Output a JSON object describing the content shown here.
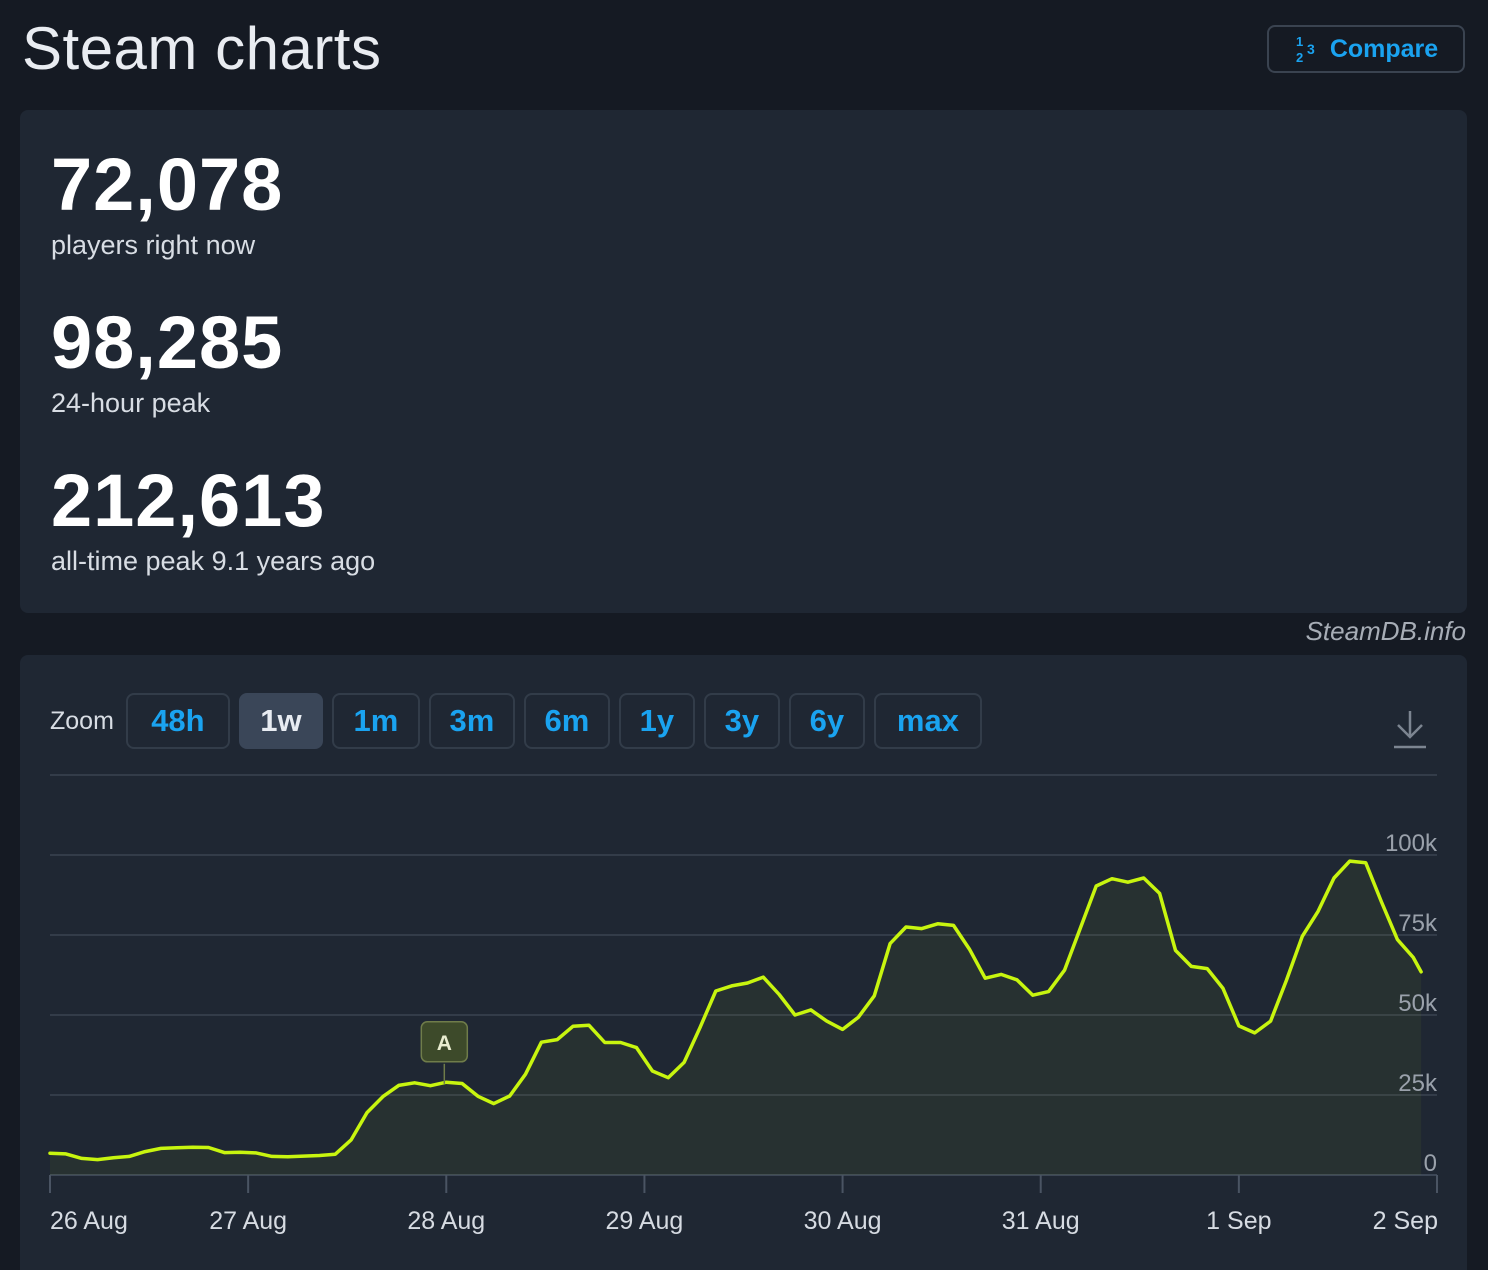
{
  "header": {
    "title": "Steam charts",
    "compare_label": "Compare",
    "compare_icon": "numbers-icon"
  },
  "stats": [
    {
      "value": "72,078",
      "label": "players right now"
    },
    {
      "value": "98,285",
      "label": "24-hour peak"
    },
    {
      "value": "212,613",
      "label": "all-time peak 9.1 years ago"
    }
  ],
  "watermark": "SteamDB.info",
  "zoom": {
    "label": "Zoom",
    "options": [
      "48h",
      "1w",
      "1m",
      "3m",
      "6m",
      "1y",
      "3y",
      "6y",
      "max"
    ],
    "active": "1w"
  },
  "download_icon": "download-icon",
  "chart_data": {
    "type": "area",
    "x_unit": "days",
    "x_ticks": [
      "26 Aug",
      "27 Aug",
      "28 Aug",
      "29 Aug",
      "30 Aug",
      "31 Aug",
      "1 Sep",
      "2 Sep"
    ],
    "y_ticks": [
      "0",
      "25k",
      "50k",
      "75k",
      "100k"
    ],
    "ylim": [
      0,
      125000
    ],
    "grid": true,
    "line_color": "#c8f50f",
    "annotation": {
      "label": "A",
      "x": 1.99,
      "y": 28500
    },
    "series": [
      {
        "values": [
          [
            0.0,
            6800
          ],
          [
            0.08,
            6600
          ],
          [
            0.16,
            5200
          ],
          [
            0.24,
            4800
          ],
          [
            0.32,
            5400
          ],
          [
            0.4,
            5800
          ],
          [
            0.48,
            7300
          ],
          [
            0.56,
            8300
          ],
          [
            0.64,
            8500
          ],
          [
            0.72,
            8700
          ],
          [
            0.8,
            8600
          ],
          [
            0.88,
            7000
          ],
          [
            0.96,
            7100
          ],
          [
            1.04,
            6900
          ],
          [
            1.12,
            5800
          ],
          [
            1.2,
            5700
          ],
          [
            1.28,
            5900
          ],
          [
            1.36,
            6100
          ],
          [
            1.44,
            6500
          ],
          [
            1.52,
            11000
          ],
          [
            1.6,
            19500
          ],
          [
            1.68,
            24500
          ],
          [
            1.76,
            28000
          ],
          [
            1.84,
            28800
          ],
          [
            1.92,
            27900
          ],
          [
            2.0,
            29000
          ],
          [
            2.08,
            28600
          ],
          [
            2.16,
            24600
          ],
          [
            2.24,
            22300
          ],
          [
            2.32,
            24700
          ],
          [
            2.4,
            31500
          ],
          [
            2.48,
            41500
          ],
          [
            2.56,
            42300
          ],
          [
            2.64,
            46500
          ],
          [
            2.72,
            46800
          ],
          [
            2.8,
            41400
          ],
          [
            2.88,
            41400
          ],
          [
            2.96,
            39800
          ],
          [
            3.04,
            32500
          ],
          [
            3.12,
            30400
          ],
          [
            3.2,
            35200
          ],
          [
            3.28,
            46000
          ],
          [
            3.36,
            57500
          ],
          [
            3.44,
            59100
          ],
          [
            3.52,
            60000
          ],
          [
            3.6,
            61800
          ],
          [
            3.68,
            56400
          ],
          [
            3.76,
            50000
          ],
          [
            3.84,
            51600
          ],
          [
            3.92,
            48100
          ],
          [
            4.0,
            45500
          ],
          [
            4.08,
            49300
          ],
          [
            4.16,
            56000
          ],
          [
            4.24,
            72300
          ],
          [
            4.32,
            77500
          ],
          [
            4.4,
            77000
          ],
          [
            4.48,
            78500
          ],
          [
            4.56,
            78000
          ],
          [
            4.64,
            70600
          ],
          [
            4.72,
            61500
          ],
          [
            4.8,
            62700
          ],
          [
            4.88,
            61000
          ],
          [
            4.96,
            56200
          ],
          [
            5.04,
            57300
          ],
          [
            5.12,
            64000
          ],
          [
            5.2,
            77100
          ],
          [
            5.28,
            90300
          ],
          [
            5.36,
            92600
          ],
          [
            5.44,
            91500
          ],
          [
            5.52,
            92800
          ],
          [
            5.6,
            88000
          ],
          [
            5.68,
            70200
          ],
          [
            5.76,
            65200
          ],
          [
            5.84,
            64500
          ],
          [
            5.92,
            58300
          ],
          [
            6.0,
            46600
          ],
          [
            6.08,
            44400
          ],
          [
            6.16,
            48100
          ],
          [
            6.24,
            60800
          ],
          [
            6.32,
            74600
          ],
          [
            6.4,
            82400
          ],
          [
            6.48,
            92800
          ],
          [
            6.56,
            98100
          ],
          [
            6.64,
            97600
          ],
          [
            6.72,
            85300
          ],
          [
            6.8,
            73600
          ],
          [
            6.88,
            68000
          ],
          [
            6.92,
            63500
          ]
        ]
      }
    ]
  }
}
